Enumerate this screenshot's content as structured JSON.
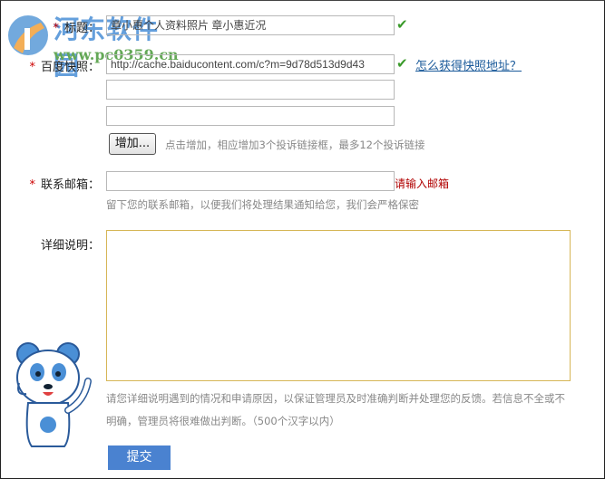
{
  "watermark": {
    "name": "河东软件园",
    "url": "www.pc0359.cn"
  },
  "form": {
    "title": {
      "label": "标题：",
      "value": "章小惠个人资料照片 章小惠近况"
    },
    "snapshot": {
      "label": "百度快照：",
      "value": "http://cache.baiducontent.com/c?m=9d78d513d9d43",
      "help_link": "怎么获得快照地址？",
      "extra_values": [
        "",
        ""
      ]
    },
    "add": {
      "button": "增加...",
      "hint": "点击增加，相应增加3个投诉链接框，最多12个投诉链接"
    },
    "email": {
      "label": "联系邮箱：",
      "value": "",
      "error": "请输入邮箱",
      "hint": "留下您的联系邮箱，以便我们将处理结果通知给您，我们会严格保密"
    },
    "detail": {
      "label": "详细说明：",
      "value": "",
      "hint_line1": "请您详细说明遇到的情况和申请原因，以保证管理员及时准确判断并处理您的反馈。若信息不全或不",
      "hint_line2": "明确，管理员将很难做出判断。（500个汉字以内）"
    },
    "required_mark": "*",
    "submit": "提交"
  },
  "colors": {
    "required": "#cc0000",
    "error": "#b00000",
    "link": "#1a5a9a",
    "submit_bg": "#4a82d0",
    "textarea_border": "#d6b656",
    "check": "#3a9a2a"
  }
}
